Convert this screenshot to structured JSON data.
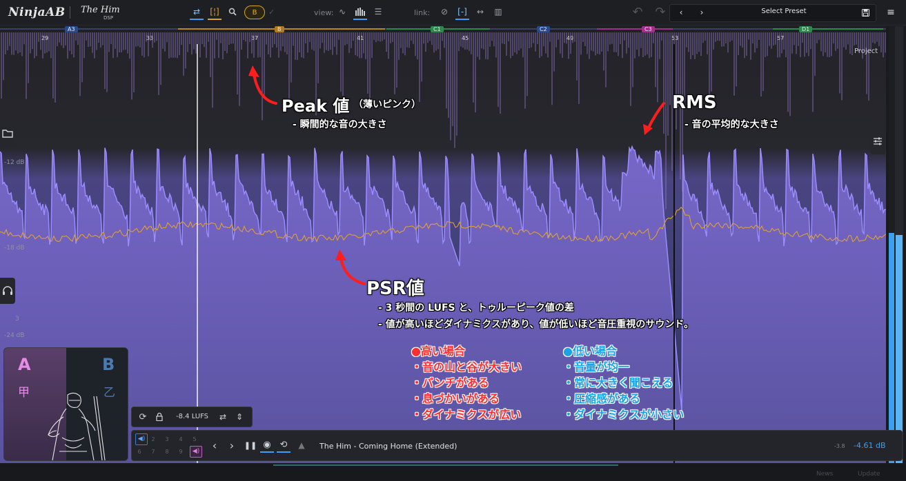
{
  "toolbar": {
    "logo_primary": "NinjaAB",
    "logo_secondary": "The Him",
    "logo_secondary_sub": "DSP",
    "ab_button": "B",
    "view_label": "view:",
    "link_label": "link:",
    "preset_label": "Select Preset"
  },
  "timeline": {
    "bars": [
      "29",
      "33",
      "37",
      "41",
      "45",
      "49",
      "53",
      "57"
    ],
    "markers": [
      {
        "label": "A3",
        "color": "#2b4a8a"
      },
      {
        "label": "B",
        "color": "#b07a1a"
      },
      {
        "label": "C1",
        "color": "#2e8a4a"
      },
      {
        "label": "C2",
        "color": "#2b4a8a"
      },
      {
        "label": "C3",
        "color": "#a0308a"
      },
      {
        "label": "D1",
        "color": "#2e8a4a"
      }
    ],
    "project_label": "Project"
  },
  "scale": {
    "db_top": "-12 dB",
    "db_mid": "-18 dB",
    "db_low": "-24 dB",
    "num_3": "3"
  },
  "annotations": {
    "peak_title": "Peak 値",
    "peak_sub": "（薄いピンク）",
    "peak_desc": "- 瞬間的な音の大きさ",
    "rms_title": "RMS",
    "rms_desc": "- 音の平均的な大きさ",
    "psr_title": "PSR値",
    "psr_desc1": "- 3 秒間の LUFS と、トゥルーピーク値の差",
    "psr_desc2": "- 値が高いほどダイナミクスがあり、値が低いほど音圧重視のサウンド。",
    "high_title": "●高い場合",
    "high_items": [
      "・音の山と谷が大きい",
      "・パンチがある",
      "・息づかいがある",
      "・ダイナミクスが広い"
    ],
    "low_title": "●低い場合",
    "low_items": [
      "・音量が均一",
      "・常に大きく聞こえる",
      "・圧縮感がある",
      "・ダイナミクスが小さい"
    ]
  },
  "ab_card": {
    "a_label": "A",
    "a_kanji": "甲",
    "b_label": "B",
    "b_kanji": "乙"
  },
  "lufs": {
    "value": "-8.4 LUFS"
  },
  "transport": {
    "slots_top": [
      "2",
      "3",
      "4",
      "5"
    ],
    "slots_bottom": [
      "6",
      "7",
      "8",
      "9"
    ],
    "track_title": "The Him - Coming Home (Extended)",
    "db_small": "-3.8",
    "db_value": "-4.61 dB"
  },
  "footer": {
    "news": "News",
    "update": "Update"
  },
  "colors": {
    "peak": "#9b7fd6",
    "rms": "#8f80ff",
    "psr": "#e0a030",
    "meter": "#3aa0f0"
  },
  "icons": [
    "swap-icon",
    "compare-icon",
    "zoom-icon",
    "waveform-icon",
    "bars-icon",
    "stack-icon",
    "unlink-icon",
    "bracket-link-icon",
    "arrows-icon",
    "columns-icon",
    "undo-icon",
    "redo-icon",
    "prev-icon",
    "next-icon",
    "save-icon",
    "menu-icon",
    "folder-icon",
    "headphones-icon",
    "sliders-icon",
    "sync-icon",
    "lock-icon",
    "loop-icon",
    "eye-icon",
    "metronome-icon",
    "speaker-icon"
  ]
}
